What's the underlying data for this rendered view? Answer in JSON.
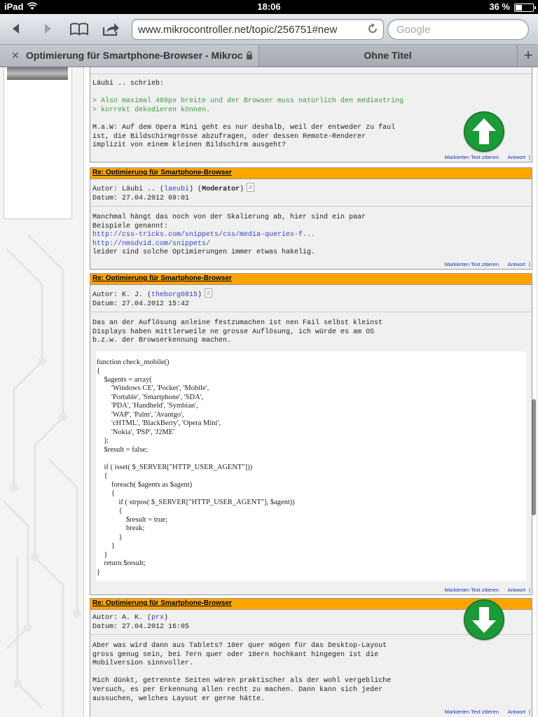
{
  "status": {
    "carrier": "iPad",
    "time": "18:06",
    "battery": "36 %",
    "battery_level": 0.36
  },
  "toolbar": {
    "url": "www.mikrocontroller.net/topic/256751#new",
    "search_placeholder": "Google"
  },
  "tabs": [
    {
      "title": "Optimierung für Smartphone-Browser - Mikrocontroller.net",
      "active": true
    },
    {
      "title": "Ohne Titel",
      "active": false
    }
  ],
  "post0": {
    "body_intro": "Läubi .. schrieb:",
    "quote1": "> Also maximal 480px breite und der Browser muss natürlich den mediastring",
    "quote2": "> korrekt dekodieren können.",
    "text": "M.a.W: Auf dem Opera Mini geht es nur deshalb, weil der entweder zu faul\nist, die Bildschirmgrösse abzufragen, oder dessen Remote-Renderer\nimplizit von einem kleinen Bildschirm ausgeht?"
  },
  "actions": {
    "quote": "Markierten Text zitieren",
    "reply": "Antwort",
    "sep": "|"
  },
  "post1": {
    "title": "Re: Optimierung für Smartphone-Browser",
    "author_prefix": "Autor: Läubi .. (",
    "author_user": "laeubi",
    "author_suffix": ") (",
    "role": "Moderator",
    "role_close": ")",
    "date": "Datum: 27.04.2012 09:01",
    "text1": "Manchmal hängt das noch von der Skalierung ab, hier sind ein paar\nBeispiele genannt:",
    "link1": "http://css-tricks.com/snippets/css/media-queries-f...",
    "link2": "http://nmsdvid.com/snippets/",
    "text2": "leider sind solche Optimierungen immer etwas hakelig."
  },
  "post2": {
    "title": "Re: Optimierung für Smartphone-Browser",
    "author_prefix": "Autor: K. J. (",
    "author_user": "theborg0815",
    "author_suffix": ")",
    "date": "Datum: 27.04.2012 15:42",
    "text": "Das an der Auflösung anleine festzumachen ist nen Fail selbst kleinst\nDisplays haben mittlerweile ne grosse Auflösung, ich würde es am OS\nb.z.w. der Browserkennung machen.",
    "code": "function check_mobile()\n{\n    $agents = array(\n        'Windows CE', 'Pocket', 'Mobile',\n        'Portable', 'Smartphone', 'SDA',\n        'PDA', 'Handheld', 'Symbian',\n        'WAP', 'Palm', 'Avantgo',\n        'cHTML', 'BlackBerry', 'Opera Mini',\n        'Nokia', 'PSP', 'J2ME'\n    );\n    $result = false;\n\n    if ( isset( $_SERVER[\"HTTP_USER_AGENT\"]))\n    {\n        foreach( $agents as $agent)\n        {\n            if ( strpos( $_SERVER[\"HTTP_USER_AGENT\"], $agent))\n            {\n                $result = true;\n                break;\n            }\n        }\n    }\n    return $result;\n}"
  },
  "post3": {
    "title": "Re: Optimierung für Smartphone-Browser",
    "author_prefix": "Autor: A. K. (",
    "author_user": "prx",
    "author_suffix": ")",
    "date": "Datum: 27.04.2012 16:05",
    "text": "Aber was wird dann aus Tablets? 10er quer mögen für das Desktop-Layout\ngross genug sein, bei 7ern quer oder 10ern hochkant hingegen ist die\nMobilversion sinnvoller.\n\nMich dünkt, getrennte Seiten wären praktischer als der wohl vergebliche\nVersuch, es per Erkennung allen recht zu machen. Dann kann sich jeder\naussuchen, welches Layout er gerne hätte."
  },
  "colors": {
    "header": "#ffa500",
    "arrow": "#1c9a3a",
    "link": "#3344cc",
    "quote": "#3a9a3a"
  },
  "icons": [
    "back-icon",
    "forward-icon",
    "bookmarks-icon",
    "share-icon",
    "reload-icon",
    "lock-icon",
    "arrow-up-icon",
    "arrow-down-icon",
    "document-icon"
  ]
}
